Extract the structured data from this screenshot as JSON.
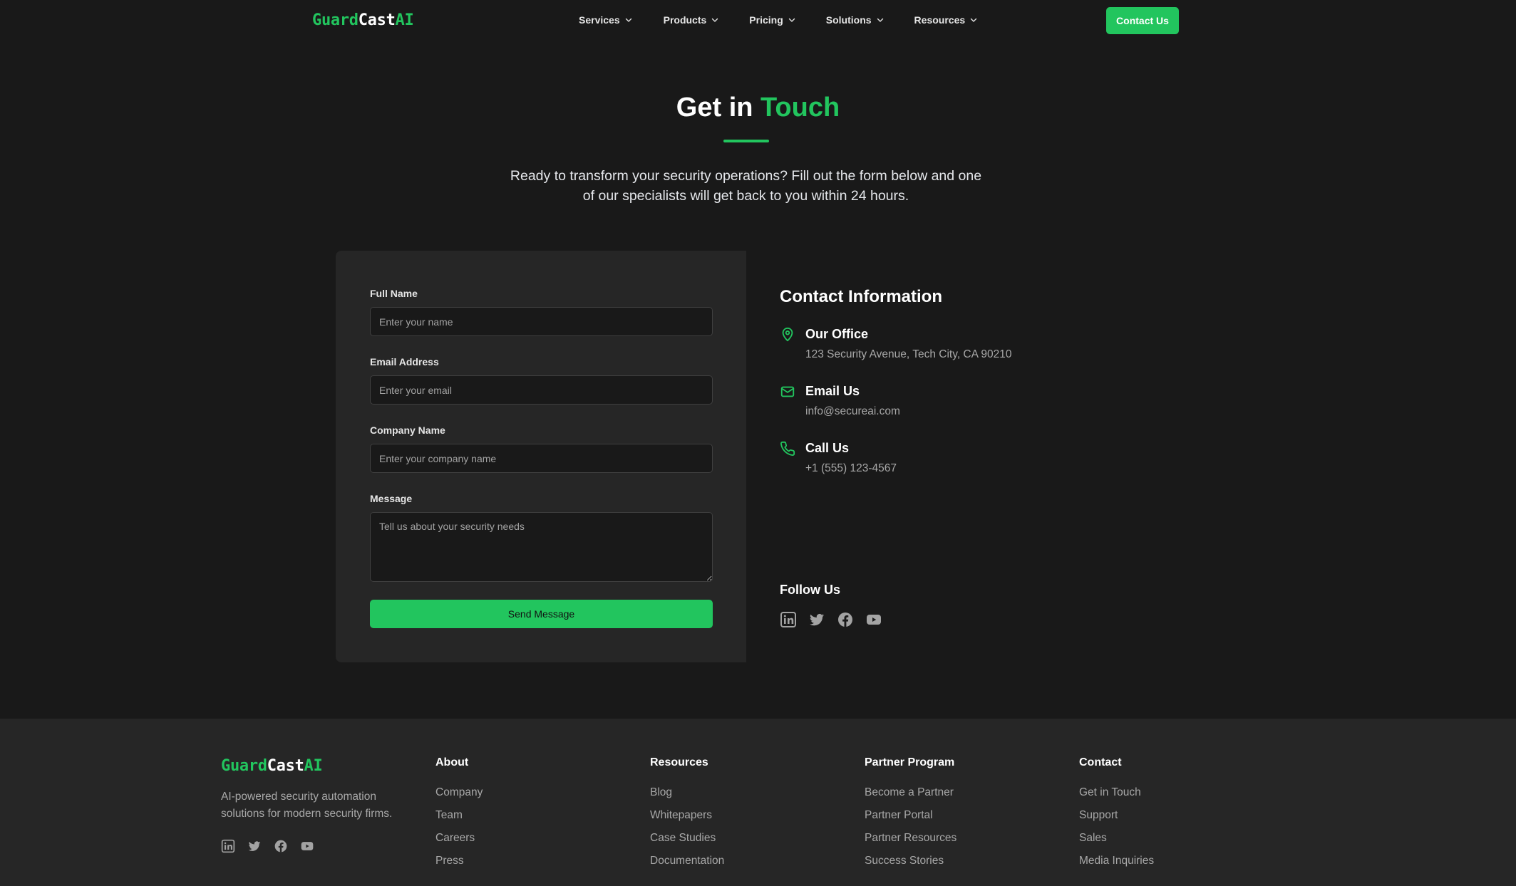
{
  "brand": {
    "part1": "Guard",
    "part2": "Cast",
    "part3": "AI",
    "accent_color": "#22c55e",
    "background_color": "#191919",
    "card_color": "#262626"
  },
  "nav": {
    "items": [
      {
        "label": "Services",
        "icon": "chevron-down-icon"
      },
      {
        "label": "Products",
        "icon": "chevron-down-icon"
      },
      {
        "label": "Pricing",
        "icon": "chevron-down-icon"
      },
      {
        "label": "Solutions",
        "icon": "chevron-down-icon"
      },
      {
        "label": "Resources",
        "icon": "chevron-down-icon"
      }
    ],
    "cta_label": "Contact Us"
  },
  "hero": {
    "title_part1": "Get in ",
    "title_accent": "Touch",
    "subtitle": "Ready to transform your security operations? Fill out the form below and one of our specialists will get back to you within 24 hours."
  },
  "form": {
    "full_name": {
      "label": "Full Name",
      "placeholder": "Enter your name",
      "value": ""
    },
    "email": {
      "label": "Email Address",
      "placeholder": "Enter your email",
      "value": ""
    },
    "company": {
      "label": "Company Name",
      "placeholder": "Enter your company name",
      "value": ""
    },
    "message": {
      "label": "Message",
      "placeholder": "Tell us about your security needs",
      "value": ""
    },
    "submit_label": "Send Message"
  },
  "contact_info": {
    "title": "Contact Information",
    "office": {
      "label": "Our Office",
      "value": "123 Security Avenue, Tech City, CA 90210",
      "icon": "map-pin-icon"
    },
    "email": {
      "label": "Email Us",
      "value": "info@secureai.com",
      "icon": "mail-icon"
    },
    "phone": {
      "label": "Call Us",
      "value": "+1 (555) 123-4567",
      "icon": "phone-icon"
    },
    "follow_title": "Follow Us",
    "socials": [
      "linkedin-icon",
      "twitter-icon",
      "facebook-icon",
      "youtube-icon"
    ]
  },
  "footer": {
    "description": "AI-powered security automation solutions for modern security firms.",
    "columns": [
      {
        "title": "About",
        "links": [
          "Company",
          "Team",
          "Careers",
          "Press"
        ]
      },
      {
        "title": "Resources",
        "links": [
          "Blog",
          "Whitepapers",
          "Case Studies",
          "Documentation"
        ]
      },
      {
        "title": "Partner Program",
        "links": [
          "Become a Partner",
          "Partner Portal",
          "Partner Resources",
          "Success Stories"
        ]
      },
      {
        "title": "Contact",
        "links": [
          "Get in Touch",
          "Support",
          "Sales",
          "Media Inquiries"
        ]
      }
    ]
  }
}
